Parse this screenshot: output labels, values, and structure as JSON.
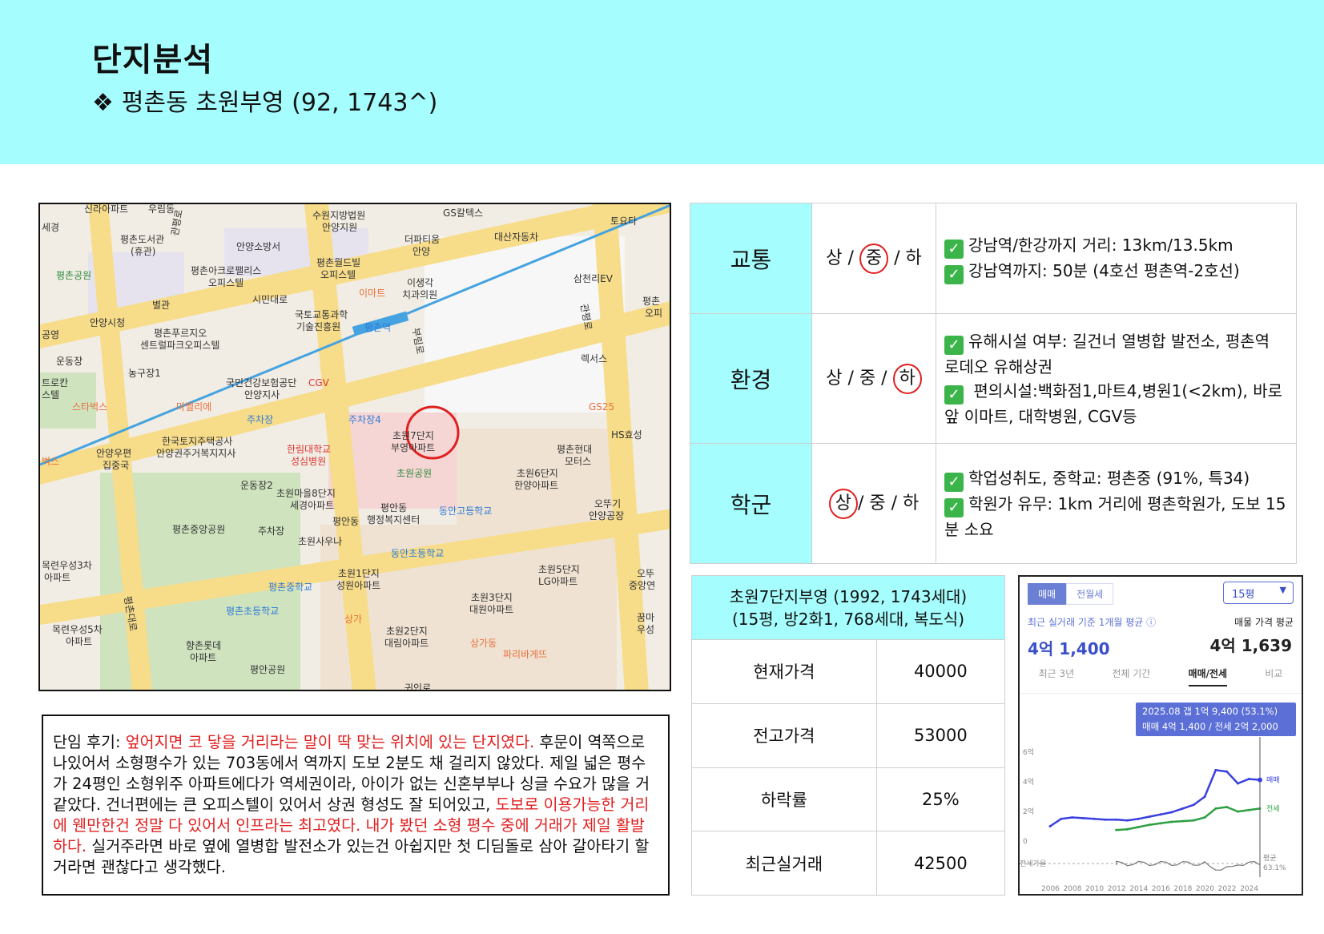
{
  "header": {
    "title": "단지분석",
    "subtitle_mark": "❖",
    "subtitle": "평촌동 초원부영 (92, 1743^)"
  },
  "map": {
    "labels": [
      "신라아파트",
      "우림동",
      "세경",
      "평촌도서관",
      "(휴관)",
      "평촌공원",
      "평촌아크로팰리스",
      "오피스텔",
      "안양소방서",
      "수원지방법원",
      "안양지원",
      "평촌월드빌",
      "오피스텔",
      "GS칼텍스",
      "더파티움",
      "안양",
      "대산자동차",
      "토요타",
      "별관",
      "안양시청",
      "시민대로",
      "국토교통과학",
      "기술진흥원",
      "이마트",
      "평촌역",
      "이생각",
      "치과의원",
      "삼천리EV",
      "평촌푸르지오",
      "센트럴파크오피스텔",
      "공영",
      "운동장",
      "농구장1",
      "국민건강보험공단",
      "안양지사",
      "CGV",
      "렉서스",
      "트로칸",
      "스텔",
      "스타벅스",
      "마벨리에",
      "주차장",
      "주차장4",
      "초원7단지",
      "부영아파트",
      "GS25",
      "HS효성",
      "한국토지주택공사",
      "안양권주거복지지사",
      "안양우편",
      "집중국",
      "한림대학교",
      "성심병원",
      "초원공원",
      "평촌현대",
      "모터스",
      "운동장2",
      "초원마을8단지",
      "세경아파트",
      "초원6단지",
      "한양아파트",
      "평안동",
      "행정복지센터",
      "동안고등학교",
      "오뚜기",
      "안양공장",
      "평촌중앙공원",
      "주차장",
      "초원사우나",
      "평안동",
      "동안초등학교",
      "목련우성3차",
      "아파트",
      "평촌중학교",
      "초원1단지",
      "성원아파트",
      "초원5단지",
      "LG아파트",
      "평촌초등학교",
      "초원3단지",
      "대원아파트",
      "목련우성5차",
      "아파트",
      "향촌롯데",
      "아파트",
      "상가",
      "초원2단지",
      "대림아파트",
      "상가동",
      "파리바게뜨",
      "평안공원",
      "꿈마",
      "우성",
      "오뚜",
      "중앙연",
      "벅스",
      "평촌",
      "오피",
      "관평로",
      "평촌대로",
      "부림로",
      "귀인로",
      "관평로"
    ]
  },
  "review": {
    "prefix": "단임 후기: ",
    "highlight1": "엎어지면 코 닿을 거리라는 말이 딱 맞는 위치에 있는 단지였다.",
    "text1": " 후문이 역쪽으로 나있어서 소형평수가 있는 703동에서 역까지 도보 2분도 채 걸리지 않았다. 제일 넓은 평수가 24평인 소형위주 아파트에다가 역세권이라, 아이가 없는 신혼부부나 싱글 수요가 많을 거 같았다. 건너편에는 큰 오피스텔이 있어서 상권 형성도 잘 되어있고, ",
    "highlight2": "도보로 이용가능한 거리에 웬만한건 정말 다 있어서 인프라는 최고였다. 내가 봤던 소형 평수 중에 거래가 제일 활발하다.",
    "text2": " 실거주라면 바로 옆에 열병합 발전소가 있는건 아쉽지만 첫 디딤돌로 삼아 갈아타기 할거라면 괜찮다고 생각했다."
  },
  "ratings": [
    {
      "category": "교통",
      "g1": "상",
      "sep1": " / ",
      "g2": "중",
      "sep2": " / ",
      "g3": "하",
      "circled": 2,
      "items": [
        "강남역/한강까지 거리: 13km/13.5km",
        "강남역까지: 50분 (4호선 평촌역-2호선)"
      ]
    },
    {
      "category": "환경",
      "g1": "상",
      "sep1": " / ",
      "g2": "중",
      "sep2": " / ",
      "g3": "하",
      "circled": 3,
      "items": [
        "유해시설 여부: 길건너 열병합 발전소, 평촌역 로데오 유해상권",
        " 편의시설:백화점1,마트4,병원1(<2km), 바로앞 이마트, 대학병원, CGV등"
      ]
    },
    {
      "category": "학군",
      "g1": "상",
      "sep1": "/ ",
      "g2": "중",
      "sep2": " / ",
      "g3": "하",
      "circled": 1,
      "items": [
        "학업성취도, 중학교: 평촌중 (91%, 특34)",
        "학원가 유무: 1km 거리에 평촌학원가, 도보 15분 소요"
      ]
    }
  ],
  "price_table": {
    "head1": "초원7단지부영 (1992, 1743세대)",
    "head2": "(15평, 방2화1, 768세대, 복도식)",
    "rows": [
      {
        "label": "현재가격",
        "value": "40000"
      },
      {
        "label": "전고가격",
        "value": "53000"
      },
      {
        "label": "하락률",
        "value": "25%"
      },
      {
        "label": "최근실거래",
        "value": "42500"
      }
    ]
  },
  "widget": {
    "tab_sale": "매매",
    "tab_jeonse": "전월세",
    "size": "15평",
    "size_arrow": "▼",
    "left_caption": "최근 실거래 기준 1개월 평균 ⓘ",
    "left_value": "4억 1,400",
    "right_caption": "매물 가격 평균",
    "right_value": "4억 1,639",
    "periods": [
      "최근 3년",
      "전체 기간",
      "매매/전세",
      "비교"
    ],
    "tooltip_line1": "2025.08  갭 1억 9,400 (53.1%)",
    "tooltip_line2": "매매 4억 1,400 / 전세 2억 2,000",
    "legend_sale": "매매",
    "legend_jeonse": "전세",
    "ratio_label": "전세가율",
    "avg_label": "평균",
    "avg_value": "63.1%"
  },
  "chart_data": {
    "type": "line",
    "title": "",
    "x": [
      2006,
      2007,
      2008,
      2009,
      2010,
      2011,
      2012,
      2013,
      2014,
      2015,
      2016,
      2017,
      2018,
      2019,
      2020,
      2021,
      2022,
      2023,
      2024,
      2025
    ],
    "x_ticks": [
      "2006",
      "2008",
      "2010",
      "2012",
      "2014",
      "2016",
      "2018",
      "2020",
      "2022",
      "2024"
    ],
    "y_ticks": [
      "6억",
      "4억",
      "2억",
      "0"
    ],
    "ylim": [
      0,
      6.5
    ],
    "series": [
      {
        "name": "매매",
        "color": "#3a40e0",
        "values": [
          1.0,
          1.5,
          1.6,
          1.55,
          1.5,
          1.45,
          1.45,
          1.4,
          1.5,
          1.65,
          1.8,
          1.95,
          2.2,
          2.45,
          3.0,
          4.8,
          4.7,
          3.9,
          4.2,
          4.14
        ]
      },
      {
        "name": "전세",
        "color": "#2ea043",
        "values": [
          0,
          0,
          0,
          0,
          0,
          0,
          0.75,
          0.8,
          0.95,
          1.1,
          1.2,
          1.3,
          1.35,
          1.4,
          1.6,
          2.2,
          2.3,
          2.0,
          2.1,
          2.2
        ]
      }
    ]
  }
}
